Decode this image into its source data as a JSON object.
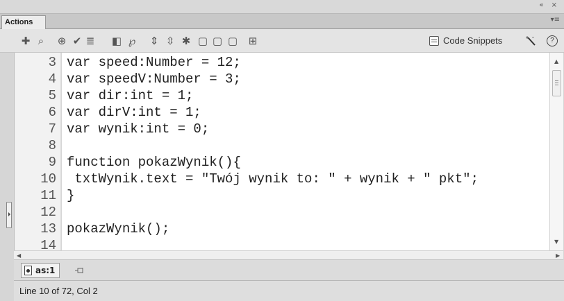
{
  "window": {
    "controls": "«  ×"
  },
  "panel": {
    "tab_label": "Actions",
    "menu_glyph": "▾≡"
  },
  "toolbar": {
    "icons": [
      {
        "name": "add-statement-icon",
        "glyph": "✚"
      },
      {
        "name": "find-icon",
        "glyph": "⌕"
      },
      {
        "name": "insert-target-path-icon",
        "glyph": "⊕"
      },
      {
        "name": "check-syntax-icon",
        "glyph": "✔"
      },
      {
        "name": "auto-format-icon",
        "glyph": "≣"
      },
      {
        "name": "show-code-hint-icon",
        "glyph": "◧"
      },
      {
        "name": "debug-options-icon",
        "glyph": "℘"
      },
      {
        "name": "collapse-between-braces-icon",
        "glyph": "⇕"
      },
      {
        "name": "collapse-selection-icon",
        "glyph": "⇳"
      },
      {
        "name": "expand-all-icon",
        "glyph": "✱"
      },
      {
        "name": "apply-block-comment-icon",
        "glyph": "▢"
      },
      {
        "name": "apply-line-comment-icon",
        "glyph": "▢"
      },
      {
        "name": "remove-comment-icon",
        "glyph": "▢"
      },
      {
        "name": "show-hide-toolbox-icon",
        "glyph": "⊞"
      }
    ],
    "code_snippets_label": "Code Snippets",
    "help_glyph": "?"
  },
  "editor": {
    "line_numbers": [
      "3",
      "4",
      "5",
      "6",
      "7",
      "8",
      "9",
      "10",
      "11",
      "12",
      "13",
      "14"
    ],
    "lines": [
      "var speed:Number = 12;",
      "var speedV:Number = 3;",
      "var dir:int = 1;",
      "var dirV:int = 1;",
      "var wynik:int = 0;",
      "",
      "function pokazWynik(){",
      " txtWynik.text = \"Twój wynik to: \" + wynik + \" pkt\";",
      "}",
      "",
      "pokazWynik();",
      ""
    ]
  },
  "file_tab": {
    "label": "as:1"
  },
  "status": {
    "text": "Line 10 of 72, Col 2"
  }
}
